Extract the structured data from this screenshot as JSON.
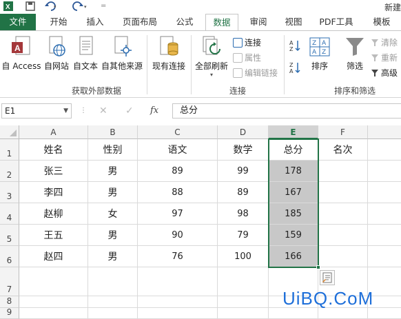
{
  "title_bar": {
    "app_icon": "excel-icon",
    "title": "新建"
  },
  "tabs": [
    "文件",
    "开始",
    "插入",
    "页面布局",
    "公式",
    "数据",
    "审阅",
    "视图",
    "PDF工具",
    "模板"
  ],
  "active_tab": "数据",
  "ribbon": {
    "groups": {
      "external": {
        "label": "获取外部数据",
        "buttons": [
          "自 Access",
          "自网站",
          "自文本",
          "自其他来源",
          "现有连接"
        ]
      },
      "connections": {
        "label": "连接",
        "refresh": "全部刷新",
        "items": [
          "连接",
          "属性",
          "编辑链接"
        ]
      },
      "sort_filter": {
        "label": "排序和筛选",
        "sort": "排序",
        "filter": "筛选",
        "items": [
          "清除",
          "重新",
          "高级"
        ]
      }
    }
  },
  "formula_bar": {
    "name_box": "E1",
    "formula": "总分",
    "fx": "fx"
  },
  "columns": [
    "A",
    "B",
    "C",
    "D",
    "E",
    "F"
  ],
  "rows": [
    "1",
    "2",
    "3",
    "4",
    "5",
    "6",
    "7",
    "8",
    "9"
  ],
  "table": {
    "header": [
      "姓名",
      "性别",
      "语文",
      "数学",
      "总分",
      "名次"
    ],
    "data": [
      [
        "张三",
        "男",
        "89",
        "99",
        "178",
        ""
      ],
      [
        "李四",
        "男",
        "88",
        "89",
        "167",
        ""
      ],
      [
        "赵柳",
        "女",
        "97",
        "98",
        "185",
        ""
      ],
      [
        "王五",
        "男",
        "90",
        "79",
        "159",
        ""
      ],
      [
        "赵四",
        "男",
        "76",
        "100",
        "166",
        ""
      ]
    ]
  },
  "selected_column": "E",
  "watermark": "UiBQ.CoM",
  "colors": {
    "excel_green": "#217346",
    "selection_fill": "#c8c8c8",
    "watermark": "#1e6fd9"
  }
}
